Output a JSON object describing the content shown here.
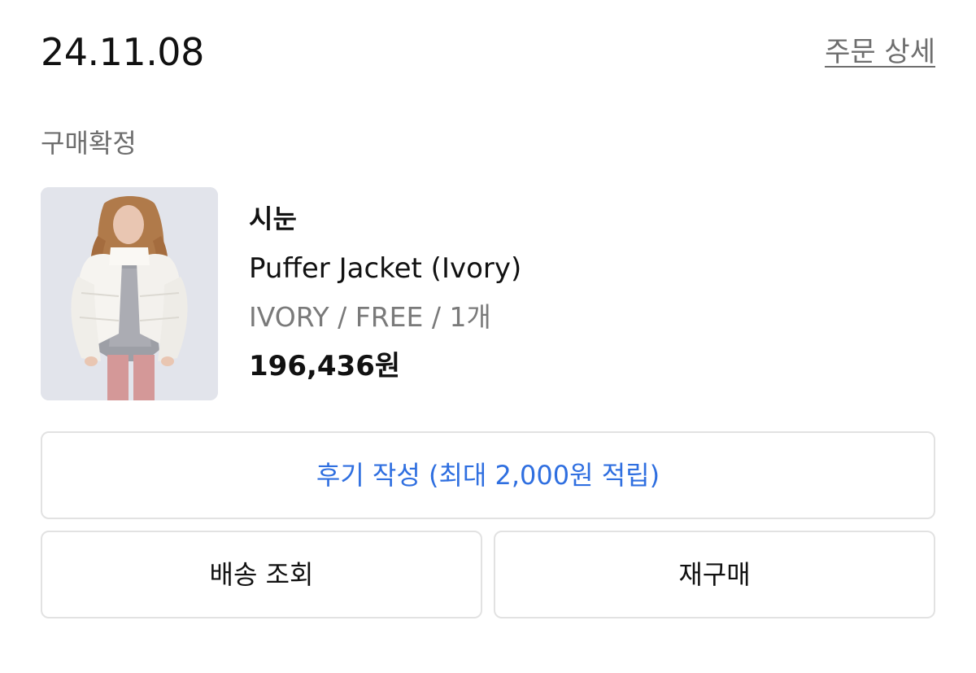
{
  "order": {
    "date": "24.11.08",
    "detail_link": "주문 상세",
    "status": "구매확정"
  },
  "product": {
    "brand": "시눈",
    "name": "Puffer Jacket (Ivory)",
    "option": "IVORY / FREE / 1개",
    "price": "196,436원",
    "image_icon": "product-photo"
  },
  "actions": {
    "review_label": "후기 작성 (최대 2,000원 적립)",
    "tracking_label": "배송 조회",
    "repurchase_label": "재구매"
  },
  "colors": {
    "accent": "#2f6fe0",
    "text_primary": "#111111",
    "text_secondary": "#6e6e6e",
    "border": "#e2e2e2"
  }
}
